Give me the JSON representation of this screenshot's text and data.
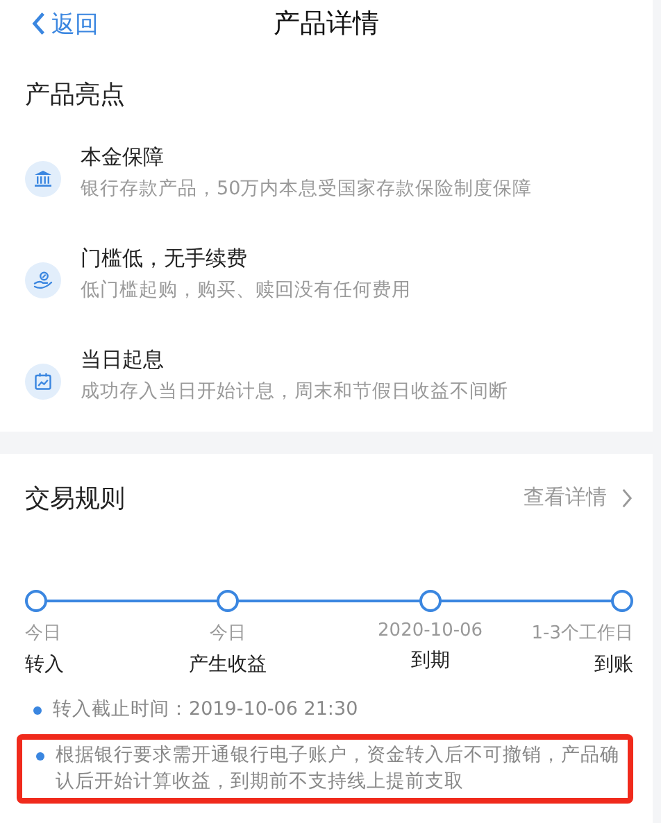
{
  "nav": {
    "back": "返回",
    "title": "产品详情"
  },
  "highlights": {
    "title": "产品亮点",
    "items": [
      {
        "kind": "bank",
        "title": "本金保障",
        "desc": "银行存款产品，50万内本息受国家存款保险制度保障"
      },
      {
        "kind": "hand-coin",
        "title": "门槛低，无手续费",
        "desc": "低门槛起购，购买、赎回没有任何费用"
      },
      {
        "kind": "calendar",
        "title": "当日起息",
        "desc": "成功存入当日开始计息，周末和节假日收益不间断"
      }
    ]
  },
  "rules": {
    "title": "交易规则",
    "link": "查看详情",
    "steps": [
      {
        "when": "今日",
        "label": "转入"
      },
      {
        "when": "今日",
        "label": "产生收益"
      },
      {
        "when": "2020-10-06",
        "label": "到期"
      },
      {
        "when": "1-3个工作日",
        "label": "到账"
      }
    ],
    "notes": [
      {
        "text": "转入截止时间：2019-10-06 21:30",
        "highlighted": false
      },
      {
        "text": "根据银行要求需开通银行电子账户，资金转入后不可撤销，产品确认后开始计算收益，到期前不支持线上提前支取",
        "highlighted": true
      }
    ]
  }
}
